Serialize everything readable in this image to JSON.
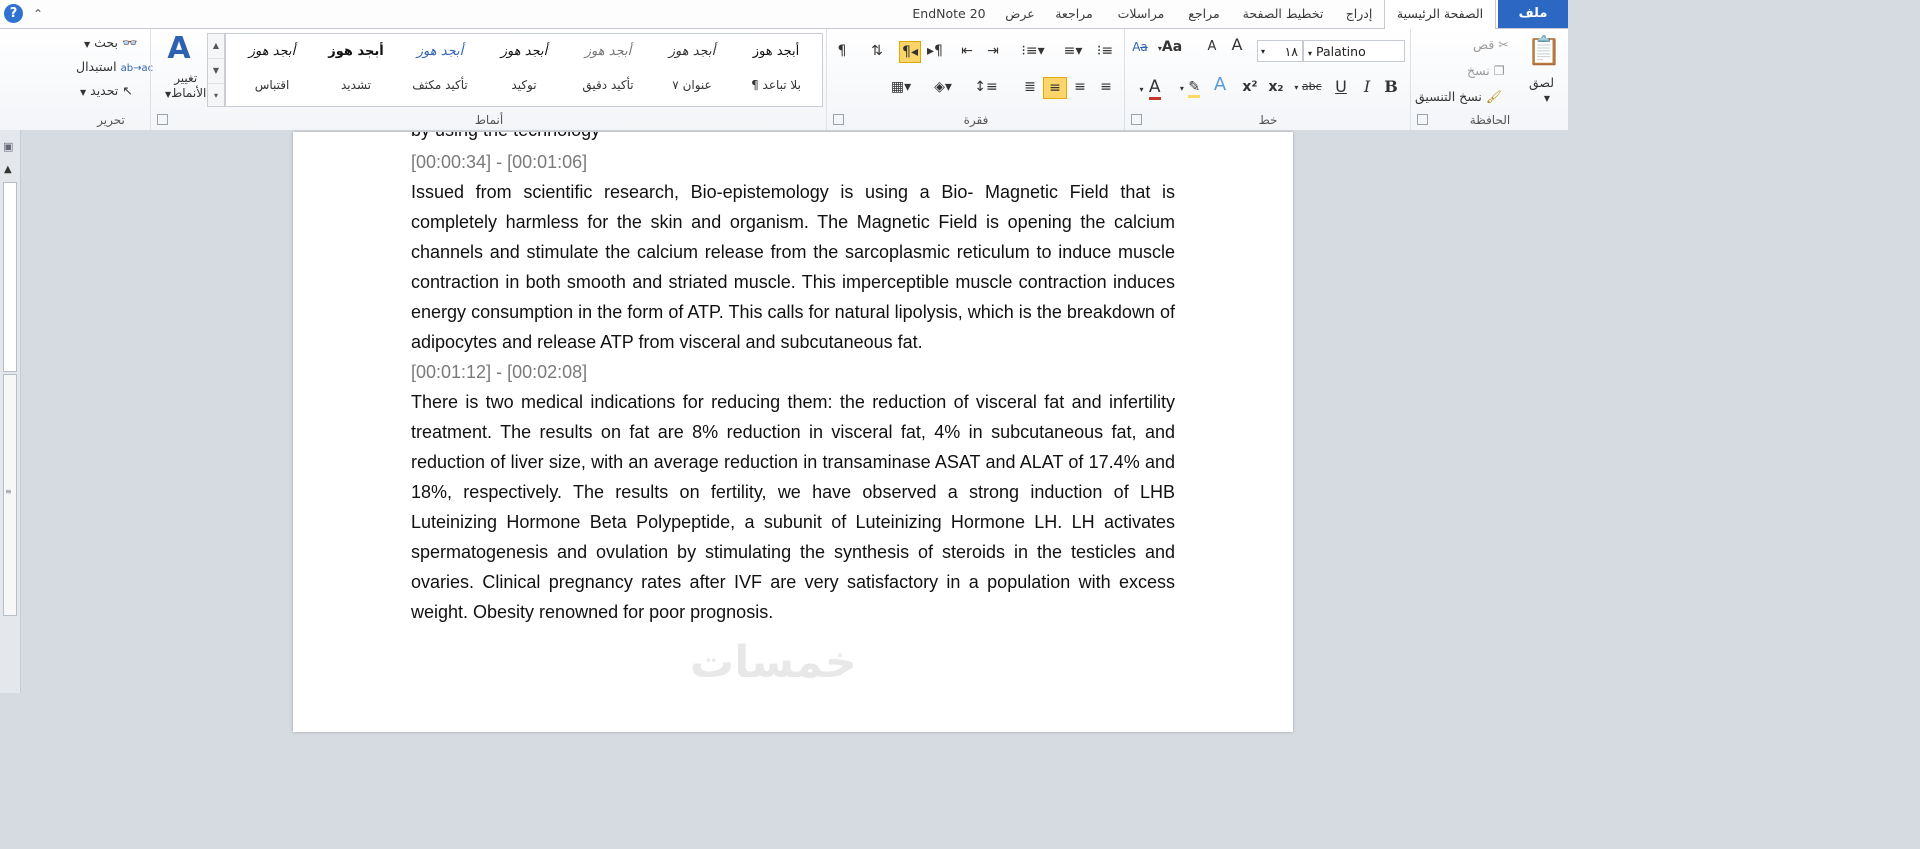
{
  "tabs": {
    "file": "ملف",
    "home": "الصفحة الرئيسية",
    "insert": "إدراج",
    "page_layout": "تخطيط الصفحة",
    "references": "مراجع",
    "mailings": "مراسلات",
    "review": "مراجعة",
    "view": "عرض",
    "endnote": "EndNote 20"
  },
  "clipboard": {
    "paste": "لصق",
    "cut": "قص",
    "copy": "نسخ",
    "format_painter": "نسخ التنسيق",
    "label": "الحافظة"
  },
  "font": {
    "name": "Palatino",
    "size": "١٨",
    "label": "خط",
    "bold": "B",
    "italic": "I",
    "underline": "U",
    "strike": "abc",
    "subscript": "x₂",
    "superscript": "x²",
    "grow": "A",
    "shrink": "A",
    "change_case": "Aa",
    "font_color": "A",
    "text_effects": "A"
  },
  "paragraph": {
    "label": "فقرة"
  },
  "styles": {
    "label": "أنماط",
    "sample": "أبجد هوز",
    "items": [
      {
        "name": "¶ بلا تباعد",
        "sample": "أبجد هوز"
      },
      {
        "name": "عنوان ٧",
        "sample": "أبجد هوز"
      },
      {
        "name": "تأكيد دقيق",
        "sample": "أبجد هوز"
      },
      {
        "name": "توكيد",
        "sample": "أبجد هوز"
      },
      {
        "name": "تأكيد مكثف",
        "sample": "أبجد هوز"
      },
      {
        "name": "تشديد",
        "sample": "أبجد هوز"
      },
      {
        "name": "اقتباس",
        "sample": "أبجد هوز"
      }
    ],
    "change_styles_line1": "تغيير",
    "change_styles_line2": "الأنماط"
  },
  "editing": {
    "find": "بحث",
    "replace": "استبدال",
    "select": "تحديد",
    "label": "تحرير"
  },
  "document": {
    "cut_line": "by using the technology",
    "blocks": [
      {
        "type": "timestamp",
        "text": "[00:00:34] - [00:01:06]"
      },
      {
        "type": "para",
        "text": "Issued from scientific research, Bio-epistemology is using a Bio- Magnetic Field that is completely harmless for the skin and organism. The Magnetic Field is opening the calcium channels and stimulate the calcium release from the sarcoplasmic reticulum to induce muscle contraction in both smooth and striated muscle. This imperceptible muscle contraction induces energy consumption in the form of ATP. This calls for natural lipolysis, which is the breakdown of adipocytes and release ATP from visceral and subcutaneous fat."
      },
      {
        "type": "timestamp",
        "text": "[00:01:12] - [00:02:08]"
      },
      {
        "type": "para",
        "text": "There is two medical indications for reducing them: the reduction of visceral fat and infertility treatment. The results on fat are 8% reduction in visceral fat, 4% in subcutaneous fat, and reduction of liver size, with an average reduction in transaminase ASAT and ALAT of 17.4% and 18%, respectively. The results on fertility, we have observed a strong induction of LHB Luteinizing Hormone Beta Polypeptide, a subunit of Luteinizing Hormone LH. LH activates spermatogenesis and ovulation by stimulating the synthesis of steroids in the testicles and ovaries. Clinical pregnancy rates after IVF are very satisfactory in a population with excess weight. Obesity renowned for poor prognosis."
      }
    ]
  },
  "watermark": "خمسات",
  "colors": {
    "file_tab": "#2b67c3",
    "timestamp": "#7a7a7a",
    "highlight": "#ffd966",
    "font_color_bar": "#c0392b"
  }
}
